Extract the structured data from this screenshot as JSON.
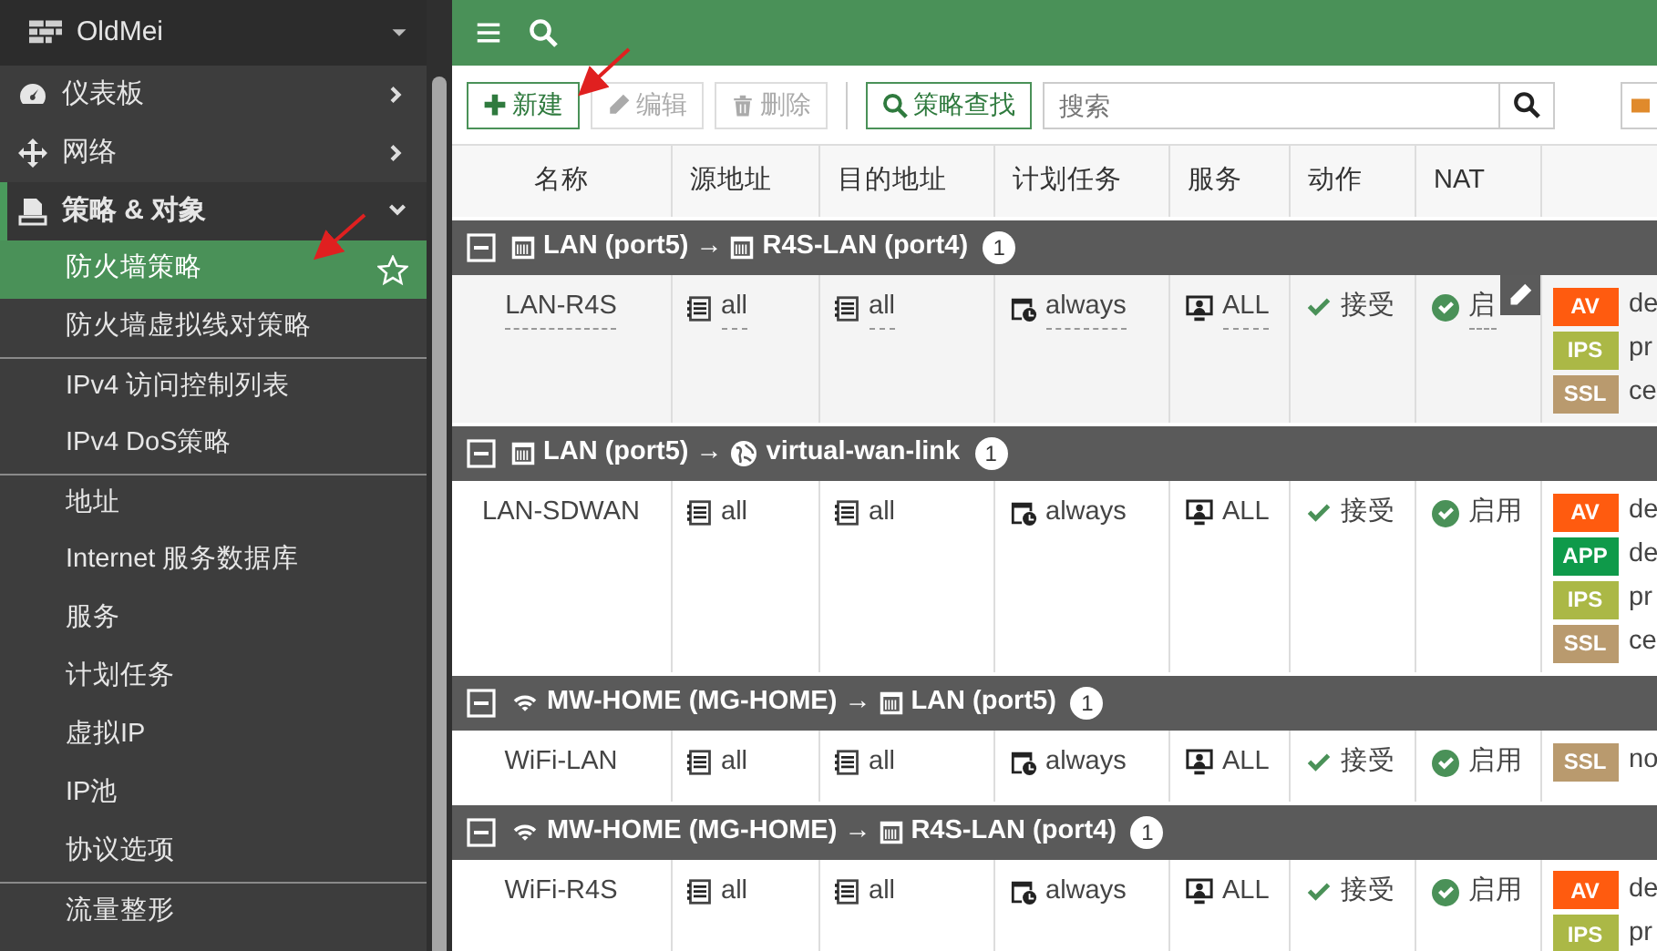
{
  "sidebar": {
    "title": "OldMei",
    "items": [
      {
        "label": "仪表板",
        "kind": "dashboard",
        "expanded": false
      },
      {
        "label": "网络",
        "kind": "network",
        "expanded": false
      },
      {
        "label": "策略 & 对象",
        "kind": "policy",
        "expanded": true,
        "children": [
          {
            "label": "防火墙策略",
            "selected": true,
            "separator_above": false
          },
          {
            "label": "防火墙虚拟线对策略",
            "selected": false,
            "separator_above": false
          },
          {
            "label": "IPv4 访问控制列表",
            "selected": false,
            "separator_above": true
          },
          {
            "label": "IPv4 DoS策略",
            "selected": false,
            "separator_above": false
          },
          {
            "label": "地址",
            "selected": false,
            "separator_above": true
          },
          {
            "label": "Internet 服务数据库",
            "selected": false,
            "separator_above": false
          },
          {
            "label": "服务",
            "selected": false,
            "separator_above": false
          },
          {
            "label": "计划任务",
            "selected": false,
            "separator_above": false
          },
          {
            "label": "虚拟IP",
            "selected": false,
            "separator_above": false
          },
          {
            "label": "IP池",
            "selected": false,
            "separator_above": false
          },
          {
            "label": "协议选项",
            "selected": false,
            "separator_above": false
          },
          {
            "label": "流量整形",
            "selected": false,
            "separator_above": true
          }
        ]
      }
    ]
  },
  "toolbar": {
    "buttons": [
      {
        "label": "新建",
        "kind": "new",
        "disabled": false
      },
      {
        "label": "编辑",
        "kind": "edit",
        "disabled": true
      },
      {
        "label": "删除",
        "kind": "delete",
        "disabled": true
      },
      {
        "label": "策略查找",
        "kind": "find",
        "disabled": false
      }
    ],
    "search": {
      "placeholder": "搜索"
    }
  },
  "table": {
    "columns": [
      "名称",
      "源地址",
      "目的地址",
      "计划任务",
      "服务",
      "动作",
      "NAT"
    ],
    "groups": [
      {
        "from": {
          "kind": "port",
          "text": "LAN (port5)"
        },
        "arrow": "→",
        "to": {
          "kind": "port",
          "text": "R4S-LAN (port4)"
        },
        "count": "1",
        "expanded": true,
        "rows": [
          {
            "name": "LAN-R4S",
            "hovered": true,
            "source": "all",
            "destination": "all",
            "schedule": "always",
            "service": "ALL",
            "action": "接受",
            "nat": "启",
            "profiles": [
              {
                "tag": "AV",
                "color": "#ff5b0f",
                "text": "de"
              },
              {
                "tag": "IPS",
                "color": "#abb846",
                "text": "pr"
              },
              {
                "tag": "SSL",
                "color": "#b99a6e",
                "text": "ce"
              }
            ]
          }
        ]
      },
      {
        "from": {
          "kind": "port",
          "text": "LAN (port5)"
        },
        "arrow": "→",
        "to": {
          "kind": "wan",
          "text": "virtual-wan-link"
        },
        "count": "1",
        "expanded": true,
        "rows": [
          {
            "name": "LAN-SDWAN",
            "hovered": false,
            "source": "all",
            "destination": "all",
            "schedule": "always",
            "service": "ALL",
            "action": "接受",
            "nat": "启用",
            "profiles": [
              {
                "tag": "AV",
                "color": "#ff5b0f",
                "text": "de"
              },
              {
                "tag": "APP",
                "color": "#0f9a4a",
                "text": "de"
              },
              {
                "tag": "IPS",
                "color": "#abb846",
                "text": "pr"
              },
              {
                "tag": "SSL",
                "color": "#b99a6e",
                "text": "ce"
              }
            ]
          }
        ]
      },
      {
        "from": {
          "kind": "wifi",
          "text": "MW-HOME (MG-HOME)"
        },
        "arrow": "→",
        "to": {
          "kind": "port",
          "text": "LAN (port5)"
        },
        "count": "1",
        "expanded": true,
        "rows": [
          {
            "name": "WiFi-LAN",
            "hovered": false,
            "source": "all",
            "destination": "all",
            "schedule": "always",
            "service": "ALL",
            "action": "接受",
            "nat": "启用",
            "profiles": [
              {
                "tag": "SSL",
                "color": "#b99a6e",
                "text": "no"
              }
            ]
          }
        ]
      },
      {
        "from": {
          "kind": "wifi",
          "text": "MW-HOME (MG-HOME)"
        },
        "arrow": "→",
        "to": {
          "kind": "port",
          "text": "R4S-LAN (port4)"
        },
        "count": "1",
        "expanded": true,
        "rows": [
          {
            "name": "WiFi-R4S",
            "hovered": false,
            "source": "all",
            "destination": "all",
            "schedule": "always",
            "service": "ALL",
            "action": "接受",
            "nat": "启用",
            "profiles": [
              {
                "tag": "AV",
                "color": "#ff5b0f",
                "text": "de"
              },
              {
                "tag": "IPS",
                "color": "#abb846",
                "text": "pr"
              }
            ]
          }
        ]
      }
    ]
  }
}
